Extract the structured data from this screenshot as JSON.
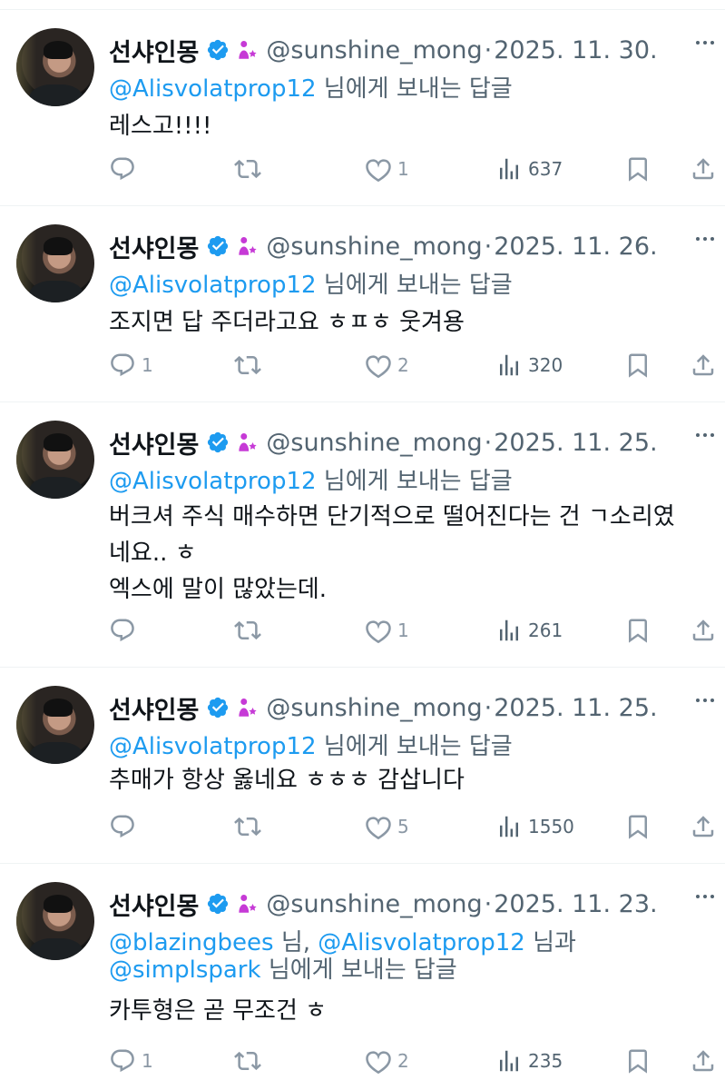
{
  "tweets": [
    {
      "name": "선샤인몽",
      "handle": "@sunshine_mong",
      "separator": "·",
      "date": "2025. 11. 30.",
      "reply_prefix": "",
      "reply_mention_1": "@Alisvolatprop12",
      "reply_mid": " 님에게 보내는 답글",
      "reply_mention_2": "",
      "reply_line2_mention": "",
      "reply_line2_suffix": "",
      "text": "레스고!!!!",
      "replies": "",
      "retweets": "",
      "likes": "1",
      "views": "637"
    },
    {
      "name": "선샤인몽",
      "handle": "@sunshine_mong",
      "separator": "·",
      "date": "2025. 11. 26.",
      "reply_mention_1": "@Alisvolatprop12",
      "reply_mid": " 님에게 보내는 답글",
      "text": "조지면 답 주더라고요 ㅎㅍㅎ 웃겨용",
      "replies": "1",
      "retweets": "",
      "likes": "2",
      "views": "320"
    },
    {
      "name": "선샤인몽",
      "handle": "@sunshine_mong",
      "separator": "·",
      "date": "2025. 11. 25.",
      "reply_mention_1": "@Alisvolatprop12",
      "reply_mid": " 님에게 보내는 답글",
      "text": "버크셔 주식 매수하면 단기적으로 떨어진다는 건 ㄱ소리였\n네요.. ㅎ\n엑스에 말이 많았는데.",
      "replies": "",
      "retweets": "",
      "likes": "1",
      "views": "261"
    },
    {
      "name": "선샤인몽",
      "handle": "@sunshine_mong",
      "separator": "·",
      "date": "2025. 11. 25.",
      "reply_mention_1": "@Alisvolatprop12",
      "reply_mid": " 님에게 보내는 답글",
      "text": "추매가 항상 옳네요 ㅎㅎㅎ 감삽니다",
      "replies": "",
      "retweets": "",
      "likes": "5",
      "views": "1550"
    },
    {
      "name": "선샤인몽",
      "handle": "@sunshine_mong",
      "separator": "·",
      "date": "2025. 11. 23.",
      "reply_mention_1": "@blazingbees",
      "reply_mid": " 님, ",
      "reply_mention_2": "@Alisvolatprop12",
      "reply_mid2": " 님과",
      "reply_line2_mention": "@simplspark",
      "reply_line2_suffix": " 님에게 보내는 답글",
      "text": "카투형은 곧 무조건 ㅎ",
      "replies": "1",
      "retweets": "",
      "likes": "2",
      "views": "235"
    }
  ],
  "icons": {
    "verified": "verified-badge-icon",
    "seed": "seedling-person-icon",
    "more": "more-icon",
    "reply": "reply-icon",
    "retweet": "retweet-icon",
    "like": "heart-icon",
    "views": "views-icon",
    "bookmark": "bookmark-icon",
    "share": "share-icon"
  },
  "colors": {
    "mention": "#1d9bf0",
    "secondary_text": "#536471",
    "icon_gray": "#8b98a5",
    "verified": "#1d9bf0",
    "seed": "#c63ad6"
  }
}
